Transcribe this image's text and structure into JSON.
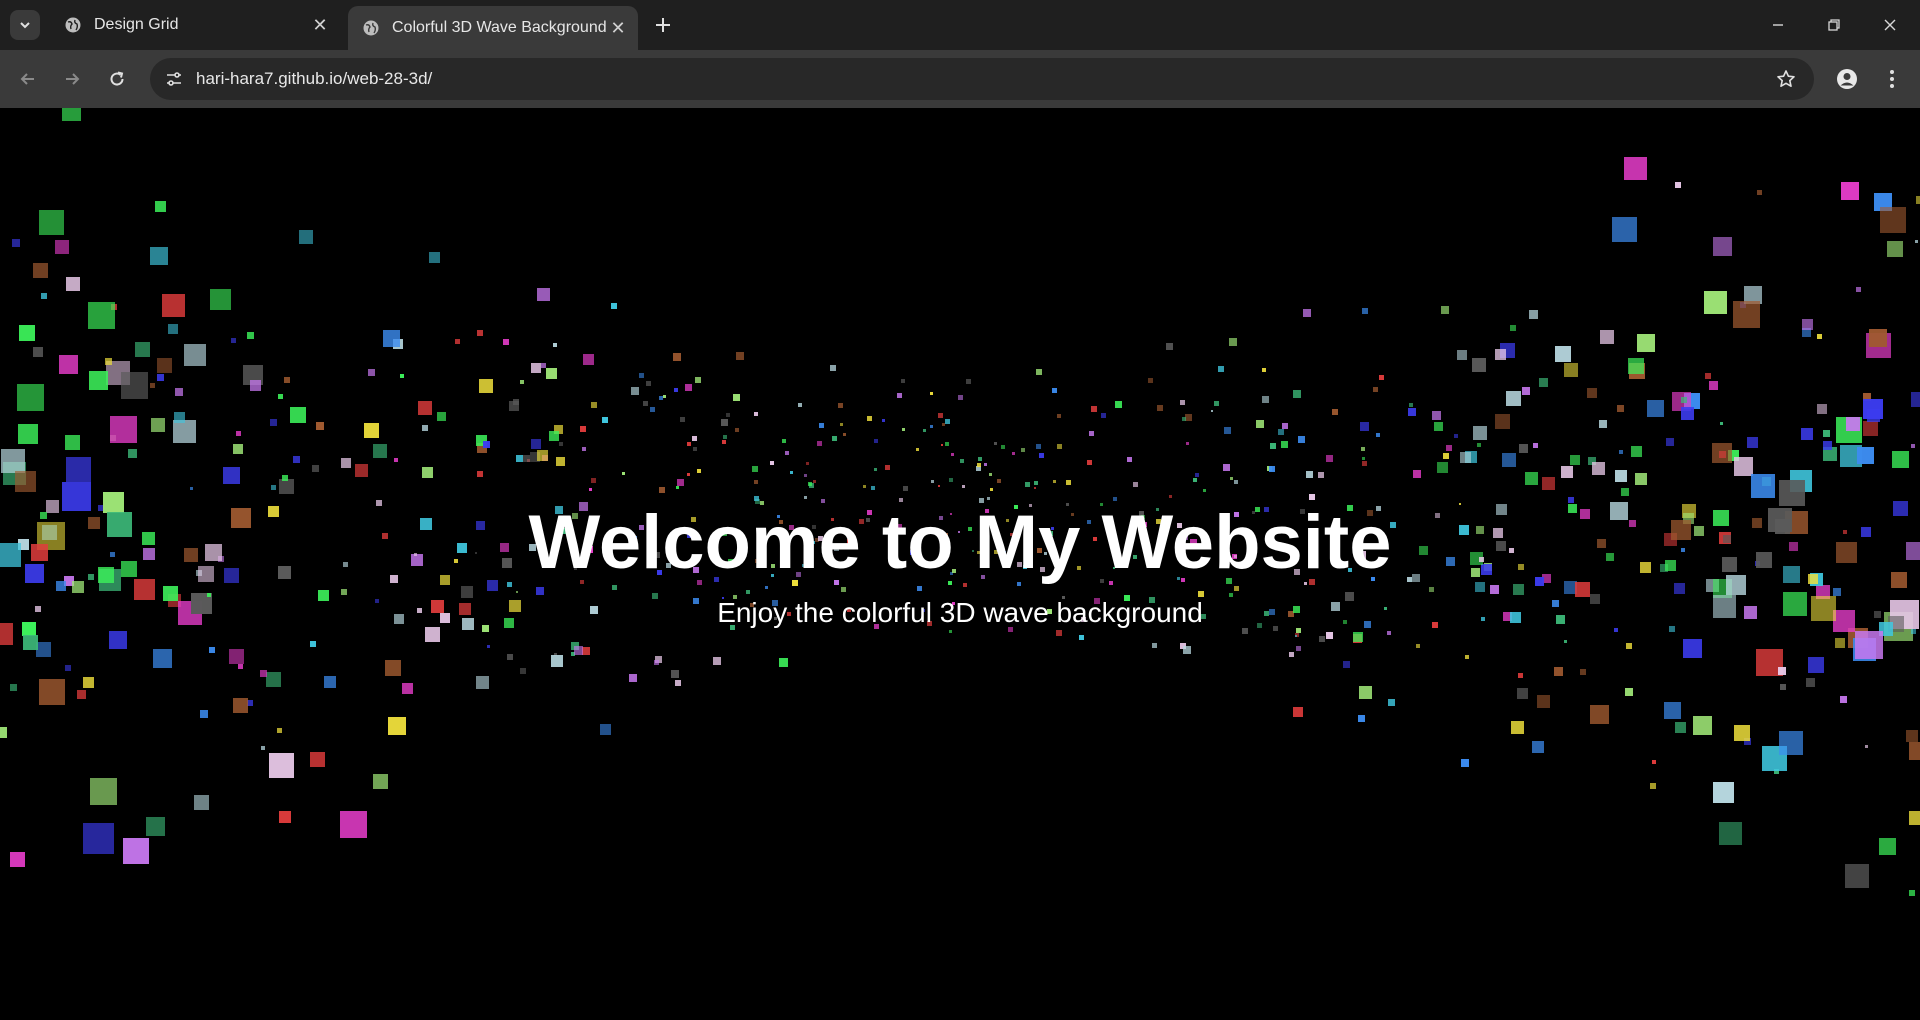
{
  "browser": {
    "tabs": [
      {
        "title": "Design Grid",
        "active": false,
        "favicon": "globe-icon"
      },
      {
        "title": "Colorful 3D Wave Background",
        "active": true,
        "favicon": "globe-icon"
      }
    ],
    "address_bar": {
      "url": "hari-hara7.github.io/web-28-3d/"
    },
    "theme": {
      "frame": "#1f1f1f",
      "toolbar": "#3a3a3a",
      "omnibox": "#282828"
    }
  },
  "page": {
    "title": "Welcome to My Website",
    "subtitle": "Enjoy the colorful 3D wave background",
    "background": "#000000",
    "particle_palette": [
      "#3cf05a",
      "#e43cc8",
      "#3c8cf0",
      "#f0e03c",
      "#a0e878",
      "#e8c8e8",
      "#3c3cf0",
      "#e03c3c",
      "#40c8e0",
      "#c878f0",
      "#b8d8e0",
      "#a05a30",
      "#5a5a5a",
      "#3cb878"
    ]
  }
}
